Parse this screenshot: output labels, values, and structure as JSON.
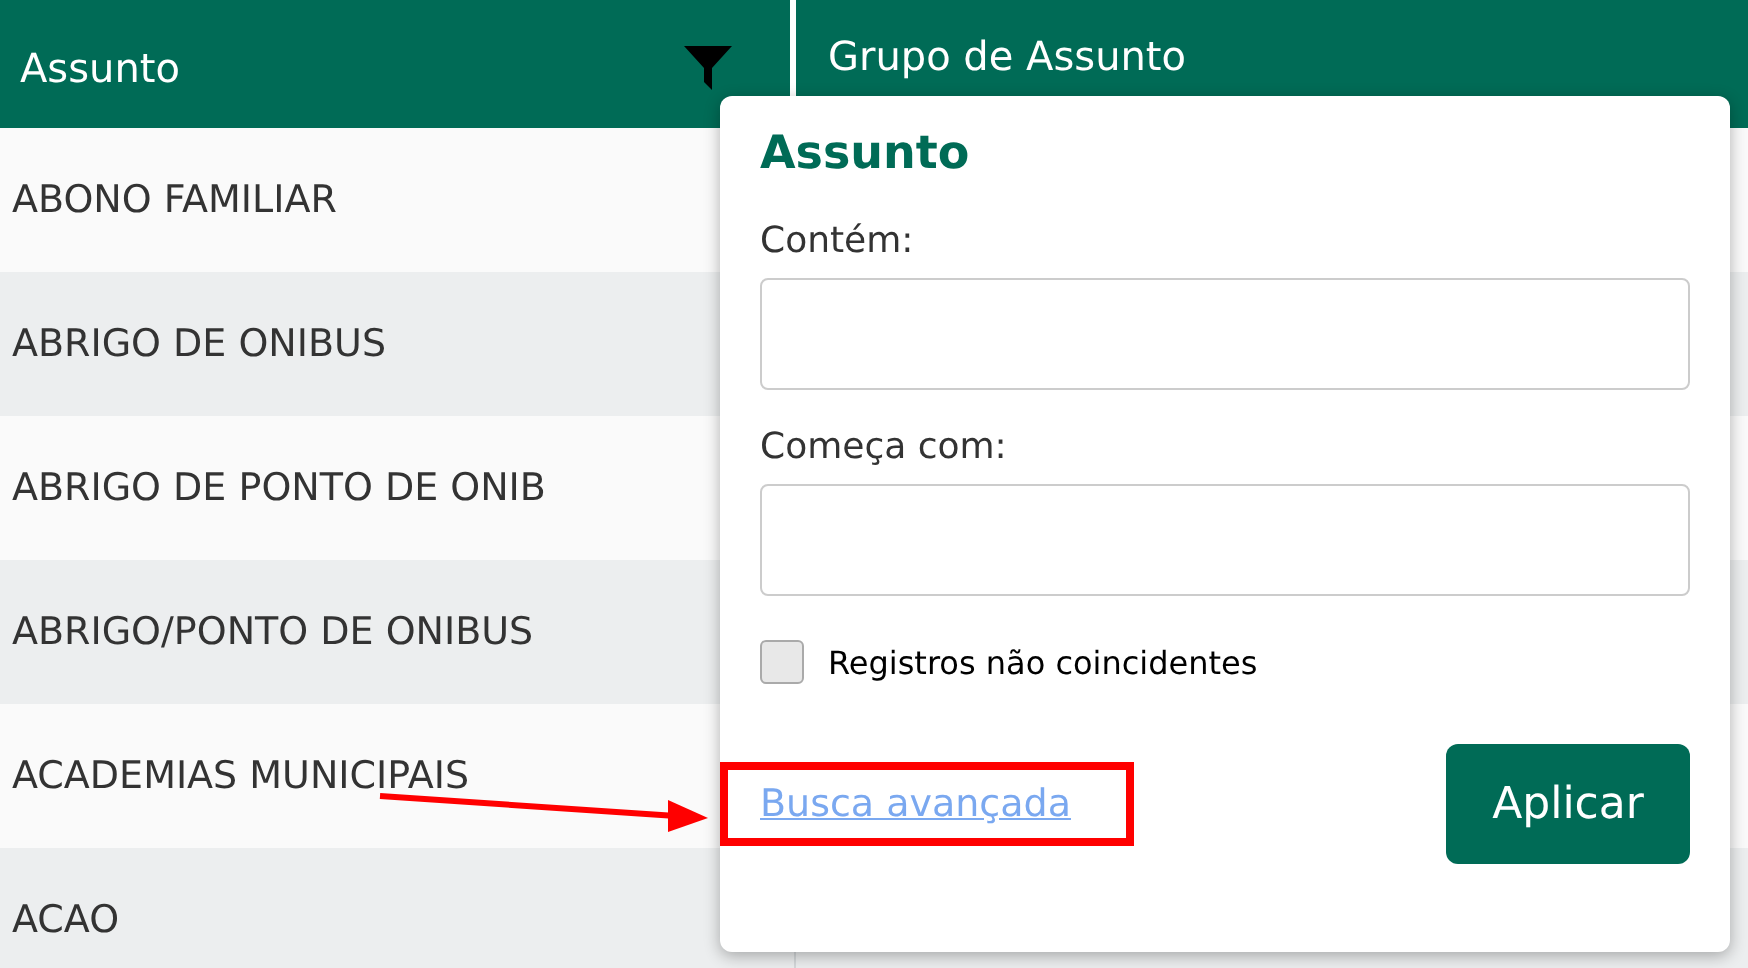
{
  "table": {
    "columns": [
      {
        "label": "Assunto",
        "filter": true
      },
      {
        "label": "Grupo de Assunto",
        "filter": false
      }
    ],
    "rows": [
      "ABONO FAMILIAR",
      "ABRIGO DE ONIBUS",
      "ABRIGO DE PONTO DE ONIB",
      "ABRIGO/PONTO DE ONIBUS",
      "ACADEMIAS MUNICIPAIS",
      "ACAO"
    ]
  },
  "filter_popup": {
    "title": "Assunto",
    "fields": [
      {
        "label": "Contém:"
      },
      {
        "label": "Começa com:"
      }
    ],
    "checkbox": {
      "label": "Registros não coincidentes",
      "checked": false
    },
    "link": "Busca avançada",
    "button": "Aplicar"
  },
  "annotation": {
    "arrow": true,
    "frame": true
  }
}
